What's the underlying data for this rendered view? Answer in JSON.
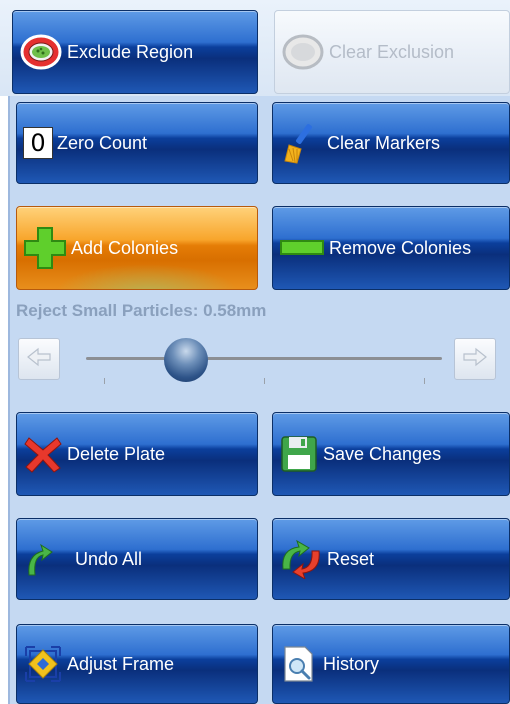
{
  "top_row": {
    "exclude_region_label": "Exclude Region",
    "clear_exclusion_label": "Clear Exclusion"
  },
  "counts": {
    "zero_count_icon_text": "0",
    "zero_count_label": "Zero Count",
    "clear_markers_label": "Clear Markers"
  },
  "colonies": {
    "add_label": "Add Colonies",
    "remove_label": "Remove Colonies"
  },
  "slider": {
    "label": "Reject Small Particles: 0.58mm",
    "position_fraction": 0.28
  },
  "plate": {
    "delete_label": "Delete Plate",
    "save_label": "Save Changes"
  },
  "undo": {
    "undo_all_label": "Undo All",
    "reset_label": "Reset"
  },
  "frame": {
    "adjust_label": "Adjust Frame",
    "history_label": "History"
  },
  "icons": {
    "exclude_region": "petri-dish-icon",
    "clear_exclusion": "petri-dish-disabled-icon",
    "zero_count": "zero-counter-icon",
    "clear_markers": "broom-icon",
    "add_colonies": "plus-icon",
    "remove_colonies": "minus-icon",
    "slider_left": "arrow-left-icon",
    "slider_right": "arrow-right-icon",
    "delete_plate": "red-x-icon",
    "save_changes": "floppy-disk-icon",
    "undo_all": "undo-arrow-icon",
    "reset": "reset-arrows-icon",
    "adjust_frame": "frame-adjust-icon",
    "history": "document-magnifier-icon"
  },
  "colors": {
    "button_blue": "#0b3f9c",
    "button_orange": "#e57d06",
    "panel_bg": "#c5d9f2",
    "label_gray": "#8aa0bd"
  }
}
